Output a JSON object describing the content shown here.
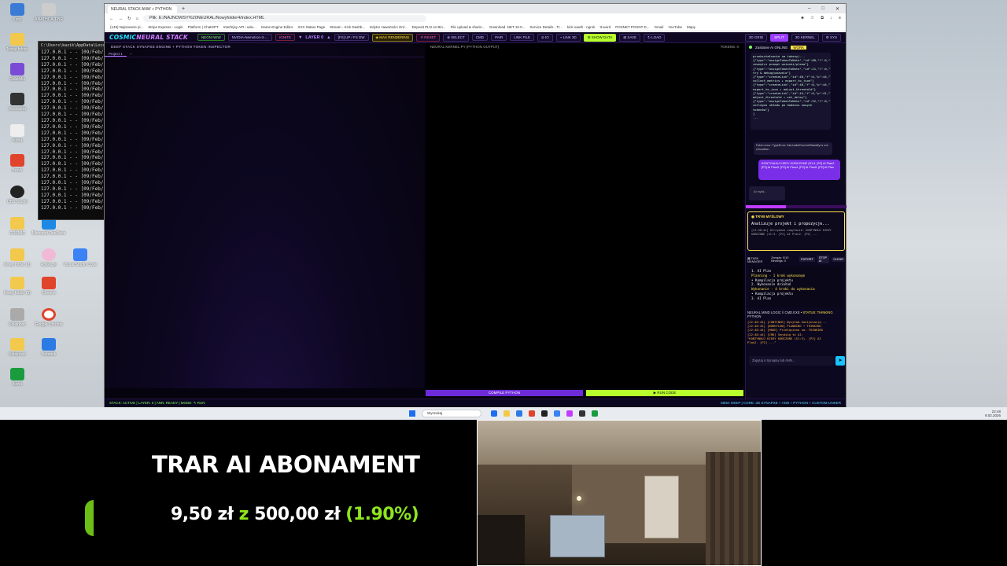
{
  "browser": {
    "tab_title": "NEURAL STACK ANW + PYTHON",
    "url_prefix": "Plik",
    "url": "E:/NAJNOWSY%20NEURAL/Nowyfolder4/index.HTML",
    "bookmarks": [
      "(149) Najnowsze pi...",
      "Stripe Express - Login",
      "Platform | ChatGPT",
      "Interfejsy API i usłu...",
      "Game Engine Editor",
      "XXX Status Page",
      "Stream - Kick Dashb...",
      "Edytor zawartości Onl...",
      "Deposit PLN on Bin...",
      "File upload & sharin...",
      "Download .NET 10.0...",
      "Service Details - Tr...",
      "kick oauth - ngrok",
      "tt-word",
      "POSNET POSNT D...",
      "Gmail",
      "YouTube",
      "Mapy"
    ]
  },
  "app": {
    "logo_a": "COSMIC",
    "logo_b": "NEURAL STACK",
    "chips": [
      "NEON NEW",
      "NVIDIA-Nemotron-3-…",
      "IGNITE",
      "▼",
      "LAYER 0",
      "▲",
      "[FS] UP / FS DW",
      "◈ MAX RENDERING",
      "⟲ RESET",
      "⊕ SELECT",
      "CMD",
      "PAIR",
      "LINK FILE",
      "⊘ IO",
      "⌁ LINK 3D",
      "⊟ SHOW DATA",
      "⊞ SAVE",
      "↻ LOAD"
    ],
    "right_chips": [
      "3D GRID",
      "SPLIT",
      "3D KERNEL",
      "⚙ SYS"
    ],
    "left_header": "DEEP STACK SYNAPSE ENGINE + PYTHON TOKEN INSPECTOR",
    "project_tab": "Project 1",
    "project_add": "+",
    "right_header": "NEURAL KERNEL.PY (PYTHON OUTPUT)",
    "right_header_tokens": "TOKENS: 0",
    "compile_button": "COMPILE PYTHON",
    "run_button": "▶ RUN CODE",
    "status_left": "STACK: ACTIVE | LAYER: 0 | ANN: READY | MODE: ✎ RUN",
    "status_right": "MEM: DEEP | CORE: 3D SYNAPSE + ANN + PYTHON + CUSTOM LINKER"
  },
  "side": {
    "header": "Zasilanie AI ONLINE",
    "work_badge": "WORK",
    "message_lines": [
      "przekształcenie na tokeny)...",
      "{\"type\":\"assignTokenToNote\",\"id\":80,\"l\":0,\"token\":\"od",
      "zewnątrz prompt wnioski/plana\"}",
      "{\"type\":\"assignTokenToNote\",\"id\":21,\"l\":0,\"layer\":0,\"token\":\"set",
      "try & debug/pozwolo\"}",
      "{\"type\":\"createLink\",\"id\":40,\"f\":0,\"p\":44,\"l\":0,\"l\":0,\"k\":0,\"",
      "collect_metrics ↓ export_to_json\"}",
      "{\"type\":\"createLink\",\"id\":40,\"f\":0,\"p\":44,\"l\":0,\"l\":0,\"k\":0,\"",
      "export_to_json ↓ adjust_threshold\"}",
      "{\"type\":\"createLink\",\"id\":44,\"f\":0,\"p\":41,\"l\":0,\"l\":0,\"k\":0,\"",
      "adjust_threshold ↓ set_delay\"}",
      "{\"type\":\"assignTokenToNote\",\"id\":52,\"l\":0,\"layer\":0,\"token\":\"bar",
      "collegio układu po dodaniu nowych tokenów\"}",
      "]",
      "..."
    ],
    "error_text": "Fetch error: TypeError: this.build/CurrentStackify is not a function",
    "user_message": "KONTYNUUJ KIEDY KOŃCZONE (S1:3. [P2] AI Plan2. [P2] AI Plan3. [P2] AI Plan4. [P2] AI Plan5. [P2] AI Plan",
    "thinking": "AI myśli...",
    "mode_title": "◉ TRYB MYŚLOWY",
    "mode_action": "Analizuje projekt i propozycje...",
    "mode_log": "[22:48:44] Otrzymano zapytanie: KONTYNUUJ KIEDY KOŃCZONE (S1:3. [P2] AI Plan2. [P2] ...",
    "task_label": "▦ TASK MANAGER",
    "task_counts": "Zamęty: 0/10 Bindings: 0",
    "task_buttons": [
      "EXPORT",
      "STOP AI",
      "CLEAR"
    ],
    "plan_lines": [
      "1. AI Plan",
      "Planning · 1 krok wykonanym",
      "• Kompilacja projektu",
      "2. Wykonanie działań",
      "Wykonanie · 4 kroki do wykonania",
      "• Kompilacja projektu",
      "3. AI Plan"
    ],
    "mind_label": "NEURAL MIND LOGIC // CMD.EXE •",
    "mind_status": "STATUS: THINKING",
    "mind_sub": "PYTHON",
    "log_lines": [
      "[22:48:44] [CONTINUE] Wysyłam kontynuację...",
      "[22:48:44] [WORKFLOW] PLANNING → THINKING",
      "[22:48:44] [MODE] Przełączono na: THINKING",
      "[22:48:44] [CMD] Sending to AI:",
      "\"KONTYNUUJ KIEDY KOŃCZONE (S1:3). [P2] AI",
      "Plan2. [P2] ...\""
    ],
    "input_placeholder": "Zapytaj o Synapsy lub ANN...",
    "send": "➤"
  },
  "terminal": {
    "title": "C:\\Users\\kazik\\AppData\\Local",
    "line": "127.0.0.1 - - [09/Feb/20"
  },
  "desktop_icons": [
    "Kosz",
    "ANATHCA.T.BR",
    "Nowy folder",
    "ColorMix",
    "Akcesoria",
    "Brave",
    "OBS Studio",
    "COSMIC",
    "Microsoft OneDrive",
    "Nowy folder (2)",
    "Aplikacje",
    "Chrome",
    "Visual Studio Code",
    "Nowy folder (3)",
    "Kolejność",
    "Google Chrome",
    "Notatnik",
    "Ikona"
  ],
  "taskbar": {
    "search": "Wyszukaj",
    "time": "22:48",
    "date": "9.02.2026"
  },
  "banner": {
    "title": "TRAR AI ABONAMENT",
    "current": "9,50 zł",
    "z": "z",
    "goal": "500,00 zł",
    "percent": "(1.90%)",
    "progress_fraction": 0.019
  },
  "colors": {
    "accent_cyan": "#22e6ff",
    "accent_violet": "#9b3dff",
    "accent_lime": "#b8ff2e",
    "accent_yellow": "#ffe34a",
    "banner_green": "#8ee61e"
  }
}
